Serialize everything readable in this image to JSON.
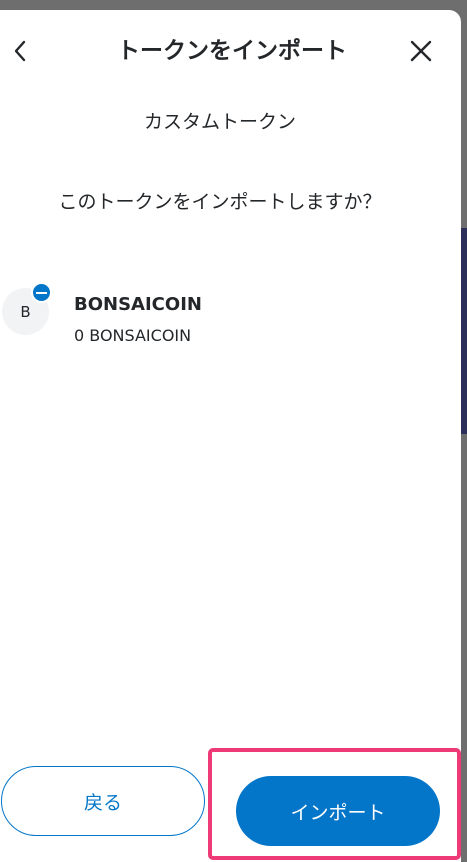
{
  "header": {
    "title": "トークンをインポート",
    "back_icon": "chevron-left-icon",
    "close_icon": "close-icon"
  },
  "content": {
    "subtitle": "カスタムトークン",
    "question": "このトークンをインポートしますか？"
  },
  "token": {
    "avatar_letter": "B",
    "name": "BONSAICOIN",
    "balance": "0 BONSAICOIN",
    "network_badge_icon": "network-badge-icon"
  },
  "footer": {
    "back_label": "戻る",
    "import_label": "インポート"
  },
  "colors": {
    "primary": "#0376c9",
    "text": "#24272a",
    "highlight": "#ee3a76"
  }
}
